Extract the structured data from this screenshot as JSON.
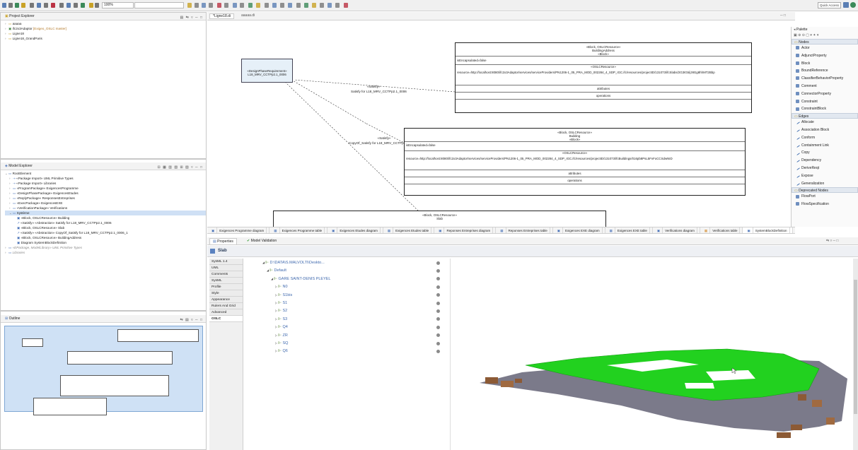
{
  "toolbar": {
    "zoom": "100%",
    "quick_access": "Quick Access"
  },
  "project_explorer": {
    "title": "Project Explorer",
    "items": [
      {
        "label": "aaaaa",
        "kind": "folder"
      },
      {
        "label": "ifc2x3Adaptor",
        "suffix": "[Exigeo_OSLC master]",
        "kind": "project"
      },
      {
        "label": "Ligne18",
        "kind": "folder"
      },
      {
        "label": "Ligne18_GrandParis",
        "kind": "folder"
      }
    ]
  },
  "editor_tabs": [
    {
      "label": "*Ligne18.di"
    },
    {
      "label": "aaaaa.di"
    }
  ],
  "model_explorer": {
    "title": "Model Explorer",
    "items": [
      {
        "label": "RootElement",
        "level": 0
      },
      {
        "label": "«Package Import» UML Primitive Types",
        "level": 1
      },
      {
        "label": "«Package Import» Libraries",
        "level": 1
      },
      {
        "label": "«ProgramPackage» ExigencesProgramme",
        "level": 1
      },
      {
        "label": "«DesignPhasePackage» ExigencesEtudes",
        "level": 1
      },
      {
        "label": "«ReplyPackage» ResponsesEntreprises",
        "level": 1
      },
      {
        "label": "«ExecPackage» ExigencesEXE",
        "level": 1
      },
      {
        "label": "«VerificationPackage» Verifications",
        "level": 1
      },
      {
        "label": "Système",
        "level": 1
      },
      {
        "label": "«Block, OSLCResource» Building",
        "level": 2
      },
      {
        "label": "«Satisfy» «Abstraction» Satisfy for L18_MRV_CCTPp2.1_0006",
        "level": 2
      },
      {
        "label": "«Block, OSLCResource» Slab",
        "level": 2
      },
      {
        "label": "«Satisfy» «Abstraction» CopyOf_Satisfy for L18_MRV_CCTPp2.1_0006_1",
        "level": 2
      },
      {
        "label": "«Block, OSLCResource» BuildingAddress",
        "level": 2
      },
      {
        "label": "Diagram SystemBlockDefinition",
        "level": 2
      },
      {
        "label": "«EPackage, ModelLibrary» UML Primitive Types",
        "level": 0
      },
      {
        "label": "Libraries",
        "level": 0
      }
    ]
  },
  "outline": {
    "title": "Outline"
  },
  "diagram": {
    "requirement": {
      "stereotype": "«DesignPhaseRequirement»",
      "name": "L18_MRV_CCTPp2.1_0006"
    },
    "satisfy1": {
      "stereotype": "«Satisfy»",
      "name": "Satisfy for L18_MRV_CCTPp2.1_0006"
    },
    "satisfy2": {
      "stereotype": "«Satisfy»",
      "name": "CopyOf_Satisfy for L18_MRV_CCTPp2.1_0006_1"
    },
    "block_address": {
      "stereotype": "«Block, OSLCResource»",
      "name": "BuildingAddress",
      "kind": "«Block»",
      "attr": "isEncapsulated=false",
      "oslc": "«OSLCResource»",
      "resource": "resource=http://localhost:8080/ifc2x3Adaptor/services/serviceProviders/PN1206-1_05_PRA_MOD_002284_4_SDP_IGC.ifc/resources/projectID/131073/ifcSlabs/2G3IG5i|J8Gg8hhMT2Bbp",
      "attributes": "attributes",
      "operations": "operations"
    },
    "block_building": {
      "stereotype": "«Block, OSLCResource»",
      "name": "Building",
      "kind": "«Block»",
      "attr": "isEncapsulated=false",
      "oslc": "«OSLCResource»",
      "resource": "resource=http://localhost:8080/ifc2x3Adaptor/services/serviceProviders/PN1206-1_05_PRA_MOD_002284_4_SDP_IGC.ifc/resources/projectID/131073/ifcBuildings/016pb8PsL5FvFoCCSdwNID",
      "attributes": "attributes",
      "operations": "operations"
    },
    "block_slab": {
      "stereotype": "«Block, OSLCResource»",
      "name": "Slab"
    }
  },
  "diagram_tabs": [
    "Exigences Programme diagram",
    "Exigences Programme table",
    "Exigences Etudes diagram",
    "Exigences Etudes table",
    "Reponses Entreprises diagram",
    "Reponses Entreprises table",
    "Exigences EXE diagram",
    "Exigences EXE table",
    "Verifications diagram",
    "Verifications table",
    "SystemBlockDefinition"
  ],
  "palette": {
    "title": "Palette",
    "nodes_header": "Nodes",
    "nodes": [
      "Actor",
      "AdjunctProperty",
      "Block",
      "BoundReference",
      "ClassifierBehaviorProperty",
      "Comment",
      "ConnectorProperty",
      "Constraint",
      "ConstraintBlock"
    ],
    "edges_header": "Edges",
    "edges": [
      "Allocate",
      "Association Block",
      "Conform",
      "Containment Link",
      "Copy",
      "Dependency",
      "DeriveReqt",
      "Expose",
      "Generalization"
    ],
    "deprecated_header": "Deprecated Nodes",
    "deprecated": [
      "FlowPort",
      "FlowSpecification"
    ]
  },
  "properties": {
    "tab_properties": "Properties",
    "tab_validation": "Model Validation",
    "selected": "Slab",
    "tabs": [
      "SysML 1.4",
      "UML",
      "Comments",
      "SysML",
      "Profile",
      "Style",
      "Appearance",
      "Rulers And Grid",
      "Advanced",
      "OSLC"
    ],
    "active_tab": "OSLC",
    "tree": [
      {
        "label": "D:\\DATA\\S.MALVOLTI\\Deskto...",
        "level": 0
      },
      {
        "label": "Default",
        "level": 1
      },
      {
        "label": "GARE SAINT-DENIS PLEYEL",
        "level": 2
      },
      {
        "label": "N0",
        "level": 3
      },
      {
        "label": "S1bis",
        "level": 3
      },
      {
        "label": "S1",
        "level": 3
      },
      {
        "label": "S2",
        "level": 3
      },
      {
        "label": "S3",
        "level": 3
      },
      {
        "label": "Q4",
        "level": 3
      },
      {
        "label": "ZR",
        "level": 3
      },
      {
        "label": "SQ",
        "level": 3
      },
      {
        "label": "Q6",
        "level": 3
      }
    ]
  }
}
